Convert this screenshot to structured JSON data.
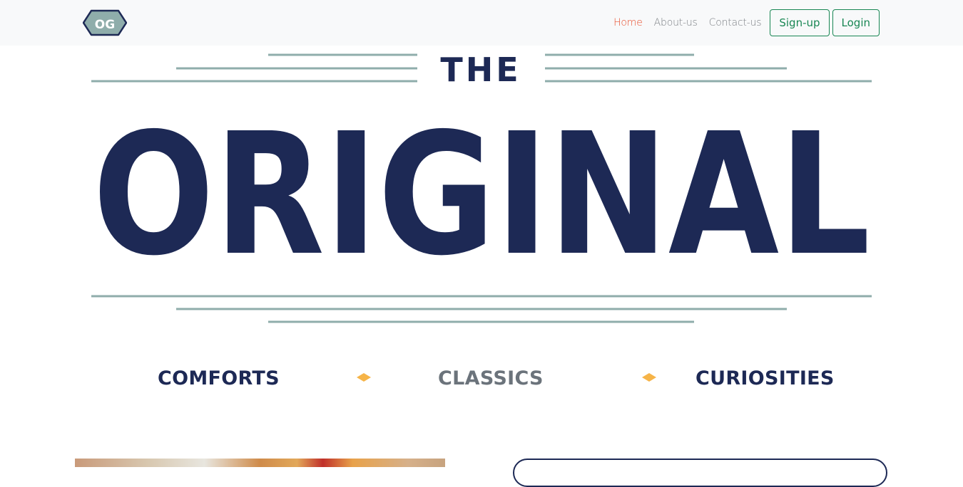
{
  "nav": {
    "logo_text": "OG",
    "links": [
      "Home",
      "About-us",
      "Contact-us"
    ],
    "signup_label": "Sign-up",
    "login_label": "Login"
  },
  "hero": {
    "the": "THE",
    "title": "ORIGINAL"
  },
  "tagline": {
    "items": [
      "COMFORTS",
      "CLASSICS",
      "CURIOSITIES"
    ]
  },
  "colors": {
    "navy": "#1d2955",
    "sage": "#8fadab",
    "accent": "#f6b448",
    "link_active": "#e8502f",
    "button_green": "#198754"
  }
}
